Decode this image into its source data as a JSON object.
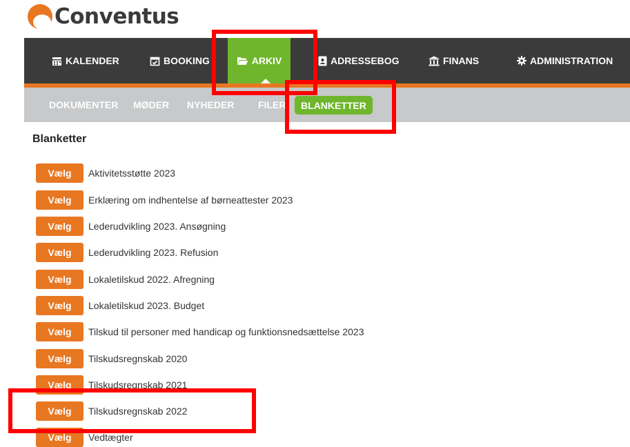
{
  "app": {
    "logo_text": "Conventus"
  },
  "main_nav": {
    "items": [
      {
        "label": "KALENDER",
        "icon": "calendar-icon"
      },
      {
        "label": "BOOKING",
        "icon": "calendar-check-icon"
      },
      {
        "label": "ARKIV",
        "icon": "folder-open-icon",
        "active": true
      },
      {
        "label": "ADRESSEBOG",
        "icon": "address-book-icon"
      },
      {
        "label": "FINANS",
        "icon": "bank-icon"
      },
      {
        "label": "ADMINISTRATION",
        "icon": "gear-icon"
      }
    ]
  },
  "sub_nav": {
    "items": [
      {
        "label": "DOKUMENTER"
      },
      {
        "label": "MØDER"
      },
      {
        "label": "NYHEDER"
      },
      {
        "label": "FILER"
      },
      {
        "label": "BLANKETTER",
        "active": true
      }
    ]
  },
  "section": {
    "title": "Blanketter"
  },
  "forms": {
    "button_label": "Vælg",
    "items": [
      {
        "label": "Aktivitetsstøtte 2023"
      },
      {
        "label": "Erklæring om indhentelse af børneattester 2023"
      },
      {
        "label": "Lederudvikling 2023. Ansøgning"
      },
      {
        "label": "Lederudvikling 2023. Refusion"
      },
      {
        "label": "Lokaletilskud 2022. Afregning"
      },
      {
        "label": "Lokaletilskud 2023. Budget"
      },
      {
        "label": "Tilskud til personer med handicap og funktionsnedsættelse 2023"
      },
      {
        "label": "Tilskudsregnskab 2020"
      },
      {
        "label": "Tilskudsregnskab 2021"
      },
      {
        "label": "Tilskudsregnskab 2022"
      },
      {
        "label": "Vedtægter"
      }
    ]
  },
  "colors": {
    "nav_bg": "#3b3b3b",
    "accent_orange": "#e87722",
    "active_green": "#6fb62c",
    "subnav_bg": "#c7c9cb",
    "annotation_red": "#ff0000"
  }
}
